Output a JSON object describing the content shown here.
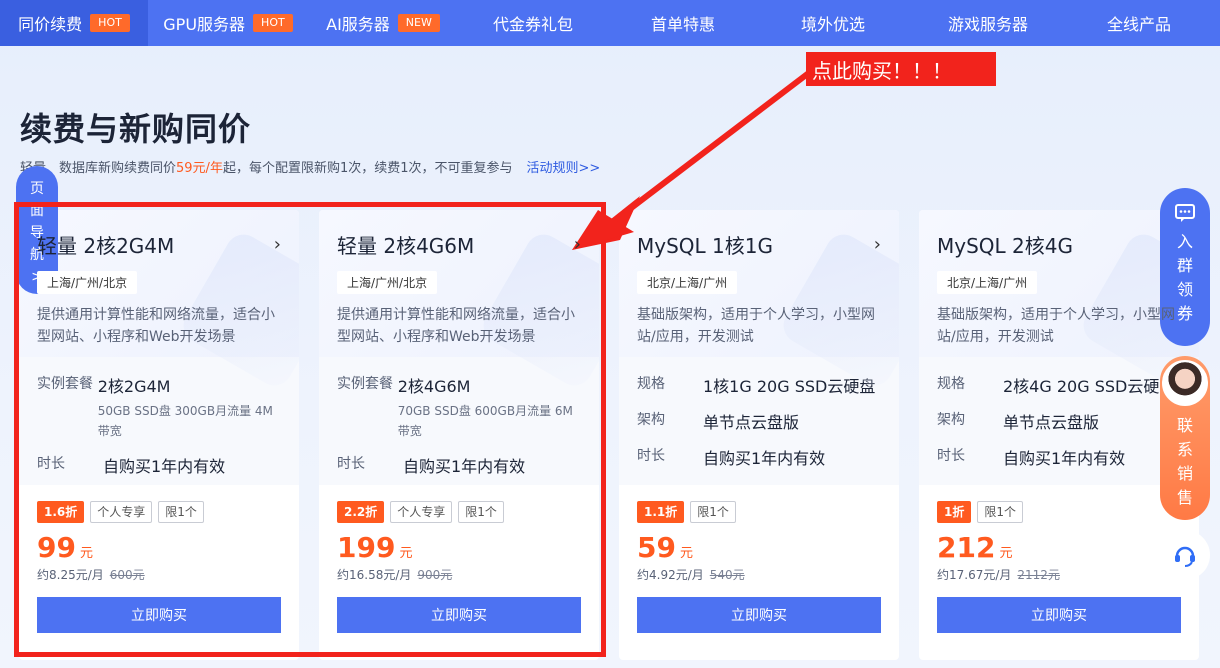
{
  "nav": [
    {
      "label": "同价续费",
      "badge": "HOT",
      "active": true
    },
    {
      "label": "GPU服务器",
      "badge": "HOT"
    },
    {
      "label": "AI服务器",
      "badge": "NEW"
    },
    {
      "label": "代金券礼包"
    },
    {
      "label": "首单特惠"
    },
    {
      "label": "境外优选"
    },
    {
      "label": "游戏服务器"
    },
    {
      "label": "全线产品"
    }
  ],
  "title": "续费与新购同价",
  "subtitle": {
    "pre": "轻量、数据库新购续费同价",
    "price": "59元/年",
    "post": "起，每个配置限新购1次，续费1次，不可重复参与",
    "rule": "活动规则>>"
  },
  "cards": [
    {
      "name": "轻量 2核2G4M",
      "region": "上海/广州/北京",
      "desc": "提供通用计算性能和网络流量，适合小型网站、小程序和Web开发场景",
      "specs": [
        {
          "k": "实例套餐",
          "v": "2核2G4M",
          "small": "50GB SSD盘 300GB月流量 4M带宽"
        },
        {
          "k": "时长",
          "v": "自购买1年内有效"
        }
      ],
      "tags": [
        "1.6折",
        "个人专享",
        "限1个"
      ],
      "price": "99",
      "unit": "元",
      "monthly": "约8.25元/月",
      "orig": "600元",
      "button": "立即购买"
    },
    {
      "name": "轻量 2核4G6M",
      "region": "上海/广州/北京",
      "desc": "提供通用计算性能和网络流量，适合小型网站、小程序和Web开发场景",
      "specs": [
        {
          "k": "实例套餐",
          "v": "2核4G6M",
          "small": "70GB SSD盘 600GB月流量 6M带宽"
        },
        {
          "k": "时长",
          "v": "自购买1年内有效"
        }
      ],
      "tags": [
        "2.2折",
        "个人专享",
        "限1个"
      ],
      "price": "199",
      "unit": "元",
      "monthly": "约16.58元/月",
      "orig": "900元",
      "button": "立即购买"
    },
    {
      "name": "MySQL 1核1G",
      "region": "北京/上海/广州",
      "desc": "基础版架构，适用于个人学习，小型网站/应用，开发测试",
      "specs": [
        {
          "k": "规格",
          "v": "1核1G 20G SSD云硬盘"
        },
        {
          "k": "架构",
          "v": "单节点云盘版"
        },
        {
          "k": "时长",
          "v": "自购买1年内有效"
        }
      ],
      "tags": [
        "1.1折",
        "限1个"
      ],
      "price": "59",
      "unit": "元",
      "monthly": "约4.92元/月",
      "orig": "540元",
      "button": "立即购买"
    },
    {
      "name": "MySQL 2核4G",
      "region": "北京/上海/广州",
      "desc": "基础版架构，适用于个人学习，小型网站/应用，开发测试",
      "specs": [
        {
          "k": "规格",
          "v": "2核4G 20G SSD云硬盘"
        },
        {
          "k": "架构",
          "v": "单节点云盘版"
        },
        {
          "k": "时长",
          "v": "自购买1年内有效"
        }
      ],
      "tags": [
        "1折",
        "限1个"
      ],
      "price": "212",
      "unit": "元",
      "monthly": "约17.67元/月",
      "orig": "2112元",
      "button": "立即购买"
    }
  ],
  "annotation": "点此购买！！！",
  "side_left": [
    "页",
    "面",
    "导",
    "航",
    ">"
  ],
  "side_right_group": [
    "入",
    "群",
    "领",
    "券"
  ],
  "side_right_sales": [
    "联",
    "系",
    "销",
    "售"
  ],
  "colors": {
    "primary": "#4d72f2",
    "accent": "#ff5a1f",
    "annotation": "#f2231c"
  }
}
